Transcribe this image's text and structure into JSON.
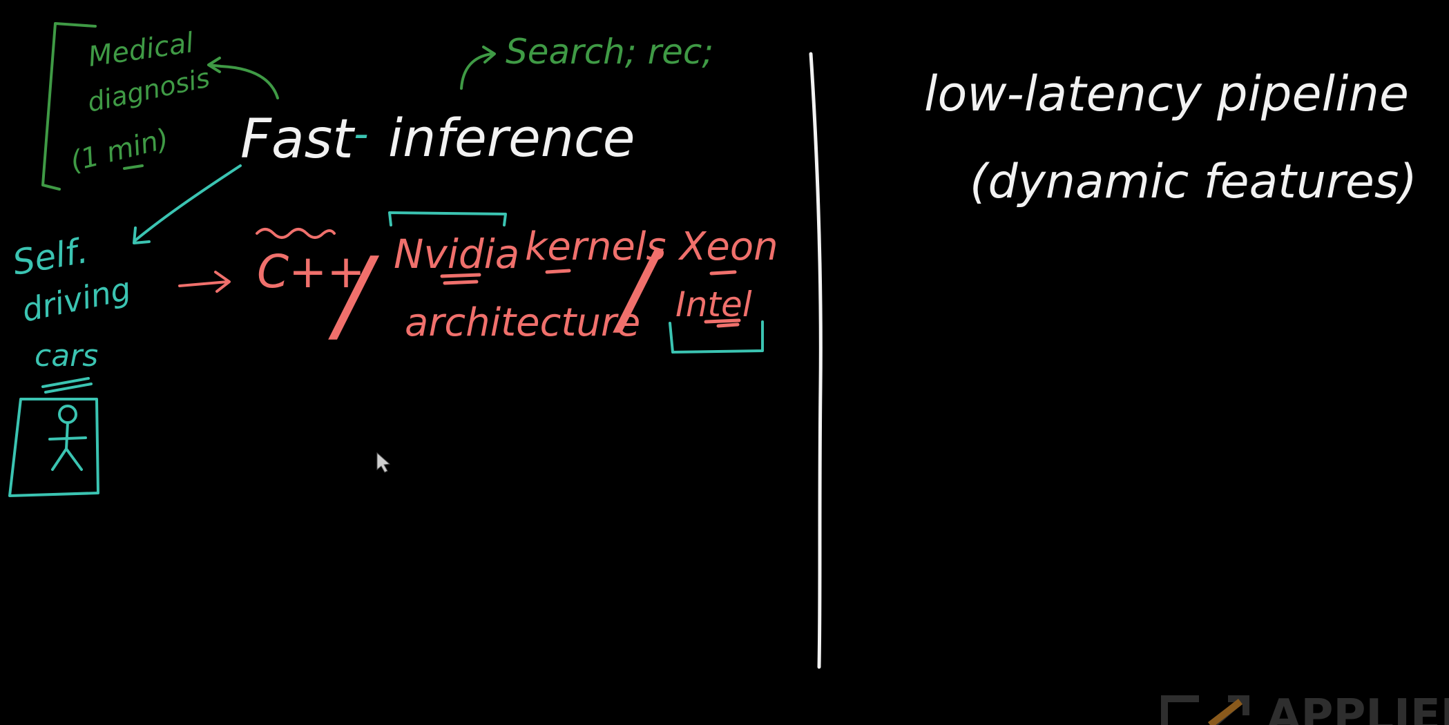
{
  "colors": {
    "background": "#000000",
    "white": "#f2f2f2",
    "green": "#3f9a45",
    "teal": "#3bc4b2",
    "salmon": "#f0706c",
    "watermark": "#2e2e2e",
    "watermark_accent": "#8a5a1c"
  },
  "left_panel": {
    "title_part1": "Fast",
    "title_dash": "-",
    "title_part2": "inference",
    "use_case_medical_line1": "Medical",
    "use_case_medical_line2": "diagnosis",
    "use_case_medical_line3": "(1 min)",
    "use_case_search": "Search; rec;",
    "use_case_selfdriving_line1": "Self.",
    "use_case_selfdriving_line2": "driving",
    "use_case_selfdriving_line3": "cars",
    "tech_cpp": "C++",
    "tech_slash1": "/",
    "tech_nvidia": "Nvidia",
    "tech_kernels": "kernels",
    "tech_architecture": "architecture",
    "tech_slash2": "/",
    "tech_xeon": "Xeon",
    "tech_intel": "Intel"
  },
  "right_panel": {
    "line1": "low-latency pipeline",
    "line2": "(dynamic features)"
  },
  "watermark": {
    "text": "APPLIED"
  }
}
